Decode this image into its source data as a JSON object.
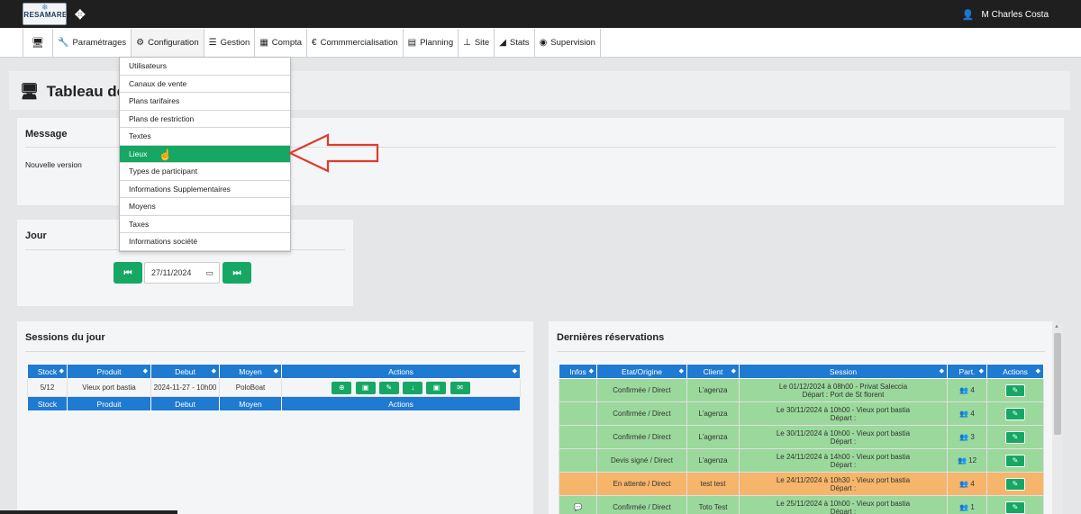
{
  "topbar": {
    "logo_text": "RESAMARE",
    "user_name": "M Charles Costa"
  },
  "menu": {
    "items": [
      {
        "label": "",
        "icon": "desktop-icon"
      },
      {
        "label": "Paramétrages",
        "icon": "wrench-icon"
      },
      {
        "label": "Configuration",
        "icon": "gears-icon"
      },
      {
        "label": "Gestion",
        "icon": "list-icon"
      },
      {
        "label": "Compta",
        "icon": "calculator-icon"
      },
      {
        "label": "Commmercialisation",
        "icon": "euro-icon"
      },
      {
        "label": "Planning",
        "icon": "calendar-icon"
      },
      {
        "label": "Site",
        "icon": "sitemap-icon"
      },
      {
        "label": "Stats",
        "icon": "area-chart-icon"
      },
      {
        "label": "Supervision",
        "icon": "eye-icon"
      }
    ]
  },
  "dropdown": {
    "items": [
      "Utilisateurs",
      "Canaux de vente",
      "Plans tarifaires",
      "Plans de restriction",
      "Textes",
      "Lieux",
      "Types de participant",
      "Informations Supplementaires",
      "Moyens",
      "Taxes",
      "Informations société"
    ],
    "active": "Lieux"
  },
  "page": {
    "title": "Tableau de bo"
  },
  "message_panel": {
    "title": "Message",
    "text": "Nouvelle version"
  },
  "jour_panel": {
    "title": "Jour",
    "date_value": "27/11/2024"
  },
  "sessions": {
    "title": "Sessions du jour",
    "headers": [
      "Stock",
      "Produit",
      "Debut",
      "Moyen",
      "Actions"
    ],
    "rows": [
      {
        "stock": "5/12",
        "produit": "Vieux port bastia",
        "debut": "2024-11-27 - 10h00",
        "moyen": "PoloBoat"
      }
    ]
  },
  "reservations": {
    "title": "Dernières réservations",
    "headers": [
      "Infos",
      "Etat/Origine",
      "Client",
      "Session",
      "Part.",
      "Actions"
    ],
    "rows": [
      {
        "status": "green",
        "infos": "",
        "etat": "Confirmée / Direct",
        "client": "L'agenza",
        "session1": "Le 01/12/2024 à 08h00 - Privat Saleccia",
        "session2": "Départ : Port de St florent",
        "part": "4"
      },
      {
        "status": "green",
        "infos": "",
        "etat": "Confirmée / Direct",
        "client": "L'agenza",
        "session1": "Le 30/11/2024 à 10h00 - Vieux port bastia",
        "session2": "Départ :",
        "part": "4"
      },
      {
        "status": "green",
        "infos": "",
        "etat": "Confirmée / Direct",
        "client": "L'agenza",
        "session1": "Le 30/11/2024 à 10h00 - Vieux port bastia",
        "session2": "Départ :",
        "part": "3"
      },
      {
        "status": "green",
        "infos": "",
        "etat": "Devis signé / Direct",
        "client": "L'agenza",
        "session1": "Le 24/11/2024 à 14h00 - Vieux port bastia",
        "session2": "Départ :",
        "part": "12"
      },
      {
        "status": "orange",
        "infos": "",
        "etat": "En attente / Direct",
        "client": "test test",
        "session1": "Le 24/11/2024 à 10h30 - Vieux port bastia",
        "session2": "Départ :",
        "part": "4"
      },
      {
        "status": "green",
        "infos": "comment",
        "etat": "Confirmée / Direct",
        "client": "Toto Test",
        "session1": "Le 25/11/2024 à 10h00 - Vieux port bastia",
        "session2": "Départ :",
        "part": "1"
      }
    ]
  },
  "colors": {
    "accent_green": "#16a765",
    "header_blue": "#1f7ad1",
    "row_green": "#9ad99b",
    "row_orange": "#f5b56b",
    "arrow_red": "#e03a2f"
  }
}
